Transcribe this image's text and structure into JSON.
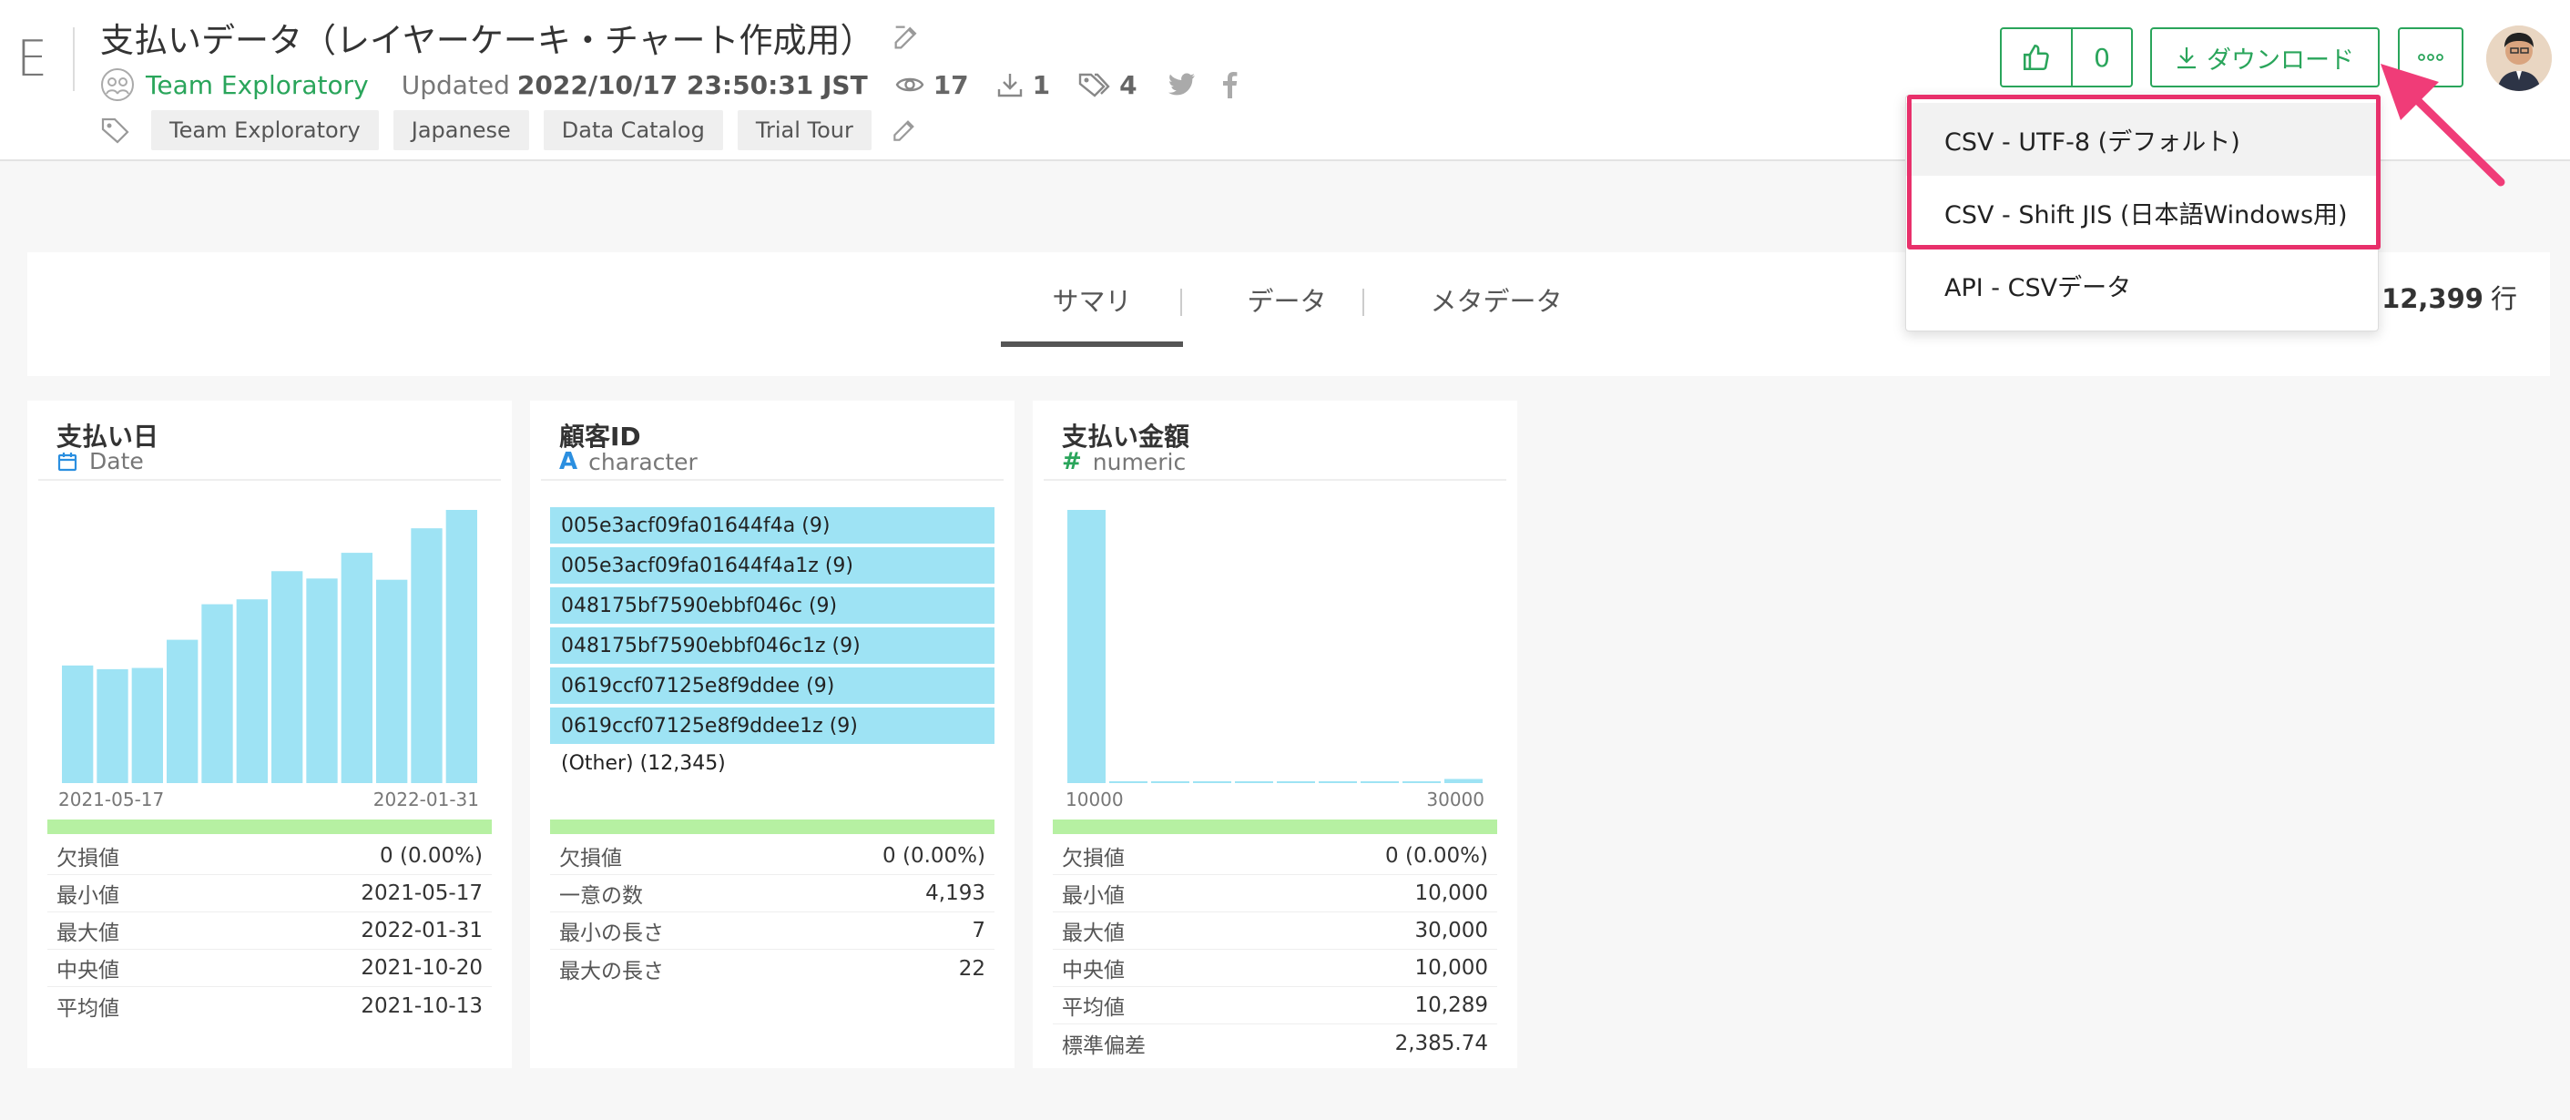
{
  "header": {
    "logo_letter": "E",
    "title": "支払いデータ（レイヤーケーキ・チャート作成用）",
    "team": "Team Exploratory",
    "updated_label": "Updated",
    "updated_value": "2022/10/17 23:50:31 JST",
    "views": "17",
    "downloads": "1",
    "tag_count": "4",
    "tags": [
      "Team Exploratory",
      "Japanese",
      "Data Catalog",
      "Trial Tour"
    ],
    "like_count": "0",
    "download_label": "ダウンロード"
  },
  "dropdown": {
    "items": [
      "CSV - UTF-8 (デフォルト)",
      "CSV - Shift JIS (日本語Windows用)",
      "API - CSVデータ"
    ],
    "highlight_color": "#e8306b"
  },
  "tabs": {
    "items": [
      "サマリ",
      "データ",
      "メタデータ"
    ],
    "active": "サマリ",
    "rows_partial": "]",
    "rows_value": "12,399",
    "rows_unit": "行"
  },
  "columns": [
    {
      "name": "支払い日",
      "type": "Date",
      "type_icon": "calendar-icon",
      "axis_min": "2021-05-17",
      "axis_max": "2022-01-31",
      "stats": [
        {
          "k": "欠損値",
          "v": "0 (0.00%)"
        },
        {
          "k": "最小値",
          "v": "2021-05-17"
        },
        {
          "k": "最大値",
          "v": "2022-01-31"
        },
        {
          "k": "中央値",
          "v": "2021-10-20"
        },
        {
          "k": "平均値",
          "v": "2021-10-13"
        }
      ]
    },
    {
      "name": "顧客ID",
      "type": "character",
      "type_icon": "text-type-icon",
      "top_values": [
        "005e3acf09fa01644f4a (9)",
        "005e3acf09fa01644f4a1z (9)",
        "048175bf7590ebbf046c (9)",
        "048175bf7590ebbf046c1z (9)",
        "0619ccf07125e8f9ddee (9)",
        "0619ccf07125e8f9ddee1z (9)"
      ],
      "other": "(Other) (12,345)",
      "stats": [
        {
          "k": "欠損値",
          "v": "0 (0.00%)"
        },
        {
          "k": "一意の数",
          "v": "4,193"
        },
        {
          "k": "最小の長さ",
          "v": "7"
        },
        {
          "k": "最大の長さ",
          "v": "22"
        }
      ]
    },
    {
      "name": "支払い金額",
      "type": "numeric",
      "type_icon": "hash-icon",
      "axis_min": "10000",
      "axis_max": "30000",
      "stats": [
        {
          "k": "欠損値",
          "v": "0 (0.00%)"
        },
        {
          "k": "最小値",
          "v": "10,000"
        },
        {
          "k": "最大値",
          "v": "30,000"
        },
        {
          "k": "中央値",
          "v": "10,000"
        },
        {
          "k": "平均値",
          "v": "10,289"
        },
        {
          "k": "標準偏差",
          "v": "2,385.74"
        }
      ]
    }
  ],
  "chart_data": [
    {
      "type": "bar",
      "title": "支払い日",
      "values": [
        960,
        930,
        940,
        1170,
        1460,
        1500,
        1730,
        1670,
        1880,
        1660,
        2080,
        2230
      ],
      "xlim_labels": [
        "2021-05-17",
        "2022-01-31"
      ]
    },
    {
      "type": "bar",
      "title": "支払い金額",
      "values": [
        11900,
        20,
        15,
        15,
        12,
        12,
        12,
        12,
        15,
        180
      ],
      "xlim": [
        10000,
        30000
      ]
    }
  ]
}
